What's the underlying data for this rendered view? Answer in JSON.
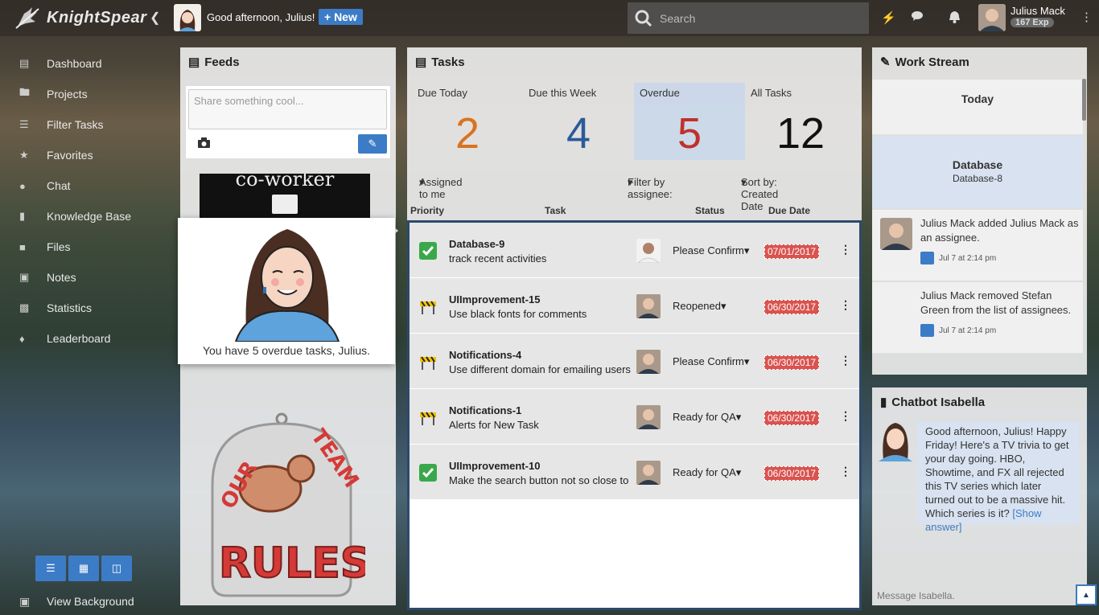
{
  "app": {
    "name": "KnightSpear"
  },
  "topbar": {
    "greeting": "Good afternoon, Julius!",
    "new_label": "+ New",
    "search_placeholder": "Search",
    "user_name": "Julius Mack",
    "user_exp": "167 Exp"
  },
  "sidebar": {
    "items": [
      {
        "label": "Dashboard",
        "icon": "dashboard-icon"
      },
      {
        "label": "Projects",
        "icon": "folder-icon"
      },
      {
        "label": "Filter Tasks",
        "icon": "filter-list-icon"
      },
      {
        "label": "Favorites",
        "icon": "star-icon"
      },
      {
        "label": "Chat",
        "icon": "chat-icon"
      },
      {
        "label": "Knowledge Base",
        "icon": "book-icon"
      },
      {
        "label": "Files",
        "icon": "file-icon"
      },
      {
        "label": "Notes",
        "icon": "note-icon"
      },
      {
        "label": "Statistics",
        "icon": "bar-chart-icon"
      },
      {
        "label": "Leaderboard",
        "icon": "trophy-icon"
      }
    ],
    "view_background": "View Background"
  },
  "feeds": {
    "title": "Feeds",
    "share_placeholder": "Share something cool...",
    "image_text": "co-worker"
  },
  "popup": {
    "message": "You have 5 overdue tasks, Julius."
  },
  "tasks": {
    "title": "Tasks",
    "stats": [
      {
        "label": "Due Today",
        "value": "2",
        "color": "#d9731f"
      },
      {
        "label": "Due this Week",
        "value": "4",
        "color": "#2a5a9a"
      },
      {
        "label": "Overdue",
        "value": "5",
        "color": "#c0312b"
      },
      {
        "label": "All Tasks",
        "value": "12",
        "color": "#111111"
      }
    ],
    "filters": {
      "assigned": "Assigned to me",
      "assignee": "Filter by assignee:",
      "sort": "Sort by: Created Date"
    },
    "columns": {
      "priority": "Priority",
      "task": "Task",
      "status": "Status",
      "due": "Due Date"
    },
    "rows": [
      {
        "id": "Database-9",
        "desc": "track recent activities",
        "status": "Please Confirm",
        "due": "07/01/2017",
        "priority_icon": "check-icon"
      },
      {
        "id": "UIImprovement-15",
        "desc": "Use black fonts for comments",
        "status": "Reopened",
        "due": "06/30/2017",
        "priority_icon": "barrier-icon"
      },
      {
        "id": "Notifications-4",
        "desc": "Use different domain for emailing users",
        "status": "Please Confirm",
        "due": "06/30/2017",
        "priority_icon": "barrier-icon"
      },
      {
        "id": "Notifications-1",
        "desc": "Alerts for New Task",
        "status": "Ready for QA",
        "due": "06/30/2017",
        "priority_icon": "barrier-icon"
      },
      {
        "id": "UIImprovement-10",
        "desc": "Make the search button not so close to",
        "status": "Ready for QA",
        "due": "06/30/2017",
        "priority_icon": "check-icon"
      }
    ]
  },
  "workstream": {
    "title": "Work Stream",
    "today": "Today",
    "db_title": "Database",
    "db_sub": "Database-8",
    "activities": [
      {
        "text": "Julius Mack added Julius Mack as an assignee.",
        "time": "Jul 7 at 2:14 pm"
      },
      {
        "text": "Julius Mack removed Stefan Green from the list of assignees.",
        "time": "Jul 7 at 2:14 pm"
      }
    ]
  },
  "chatbot": {
    "title": "Chatbot Isabella",
    "message": "Good afternoon, Julius! Happy Friday! Here's a TV trivia to get your day going. HBO, Showtime, and FX all rejected this TV series which later turned out to be a massive hit. Which series is it?",
    "link": "[Show answer]",
    "input_placeholder": "Message Isabella."
  }
}
